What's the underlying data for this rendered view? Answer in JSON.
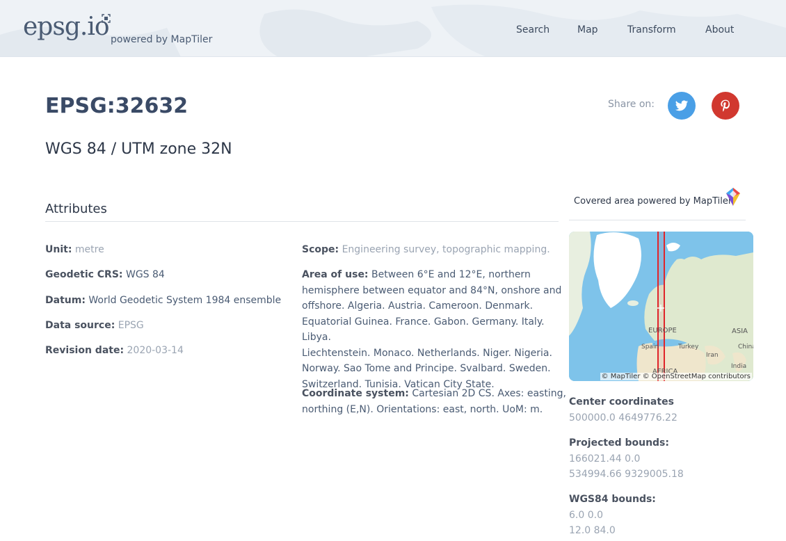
{
  "header": {
    "logo_text": "epsg.io",
    "powered_by": "powered by MapTiler",
    "nav": [
      "Search",
      "Map",
      "Transform",
      "About"
    ]
  },
  "crs": {
    "code": "EPSG:32632",
    "name": "WGS 84 / UTM zone 32N"
  },
  "share": {
    "label": "Share on:",
    "twitter_icon": "twitter-icon",
    "pinterest_icon": "pinterest-icon"
  },
  "attributes": {
    "heading": "Attributes",
    "unit": {
      "label": "Unit:",
      "value": "metre"
    },
    "geodetic_crs": {
      "label": "Geodetic CRS:",
      "value": "WGS 84"
    },
    "datum": {
      "label": "Datum:",
      "value": "World Geodetic System 1984 ensemble"
    },
    "data_source": {
      "label": "Data source:",
      "value": "EPSG"
    },
    "revision_date": {
      "label": "Revision date:",
      "value": "2020-03-14"
    },
    "scope": {
      "label": "Scope:",
      "value": "Engineering survey, topographic mapping."
    },
    "area_of_use": {
      "label": "Area of use:",
      "lines": [
        "Between 6°E and 12°E, northern",
        "hemisphere between equator and 84°N, onshore and",
        "offshore. Algeria. Austria. Cameroon. Denmark.",
        "Equatorial Guinea. France. Gabon. Germany. Italy. Libya.",
        "Liechtenstein. Monaco. Netherlands. Niger. Nigeria.",
        "Norway. Sao Tome and Principe. Svalbard. Sweden.",
        "Switzerland. Tunisia. Vatican City State."
      ]
    },
    "coordinate_system": {
      "label": "Coordinate system:",
      "lines": [
        "Cartesian 2D CS. Axes: easting,",
        "northing (E,N). Orientations: east, north. UoM: m."
      ]
    }
  },
  "map": {
    "covered_label": "Covered area powered by MapTiler",
    "attribution": "© MapTiler © OpenStreetMap contributors",
    "labels": {
      "europe": "EUROPE",
      "asia": "ASIA",
      "africa": "AFRICA",
      "spain": "Spain",
      "turkey": "Turkey",
      "iran": "Iran",
      "china": "China",
      "india": "India"
    },
    "colors": {
      "ocean": "#7ec3ea",
      "land": "#dfe9cf",
      "ice": "#ffffff",
      "zone": "#e0242a"
    }
  },
  "bounds": {
    "center": {
      "label": "Center coordinates",
      "value": "500000.0 4649776.22"
    },
    "projected": {
      "label": "Projected bounds:",
      "values": [
        "166021.44 0.0",
        "534994.66 9329005.18"
      ]
    },
    "wgs84": {
      "label": "WGS84 bounds:",
      "values": [
        "6.0 0.0",
        "12.0 84.0"
      ]
    }
  }
}
